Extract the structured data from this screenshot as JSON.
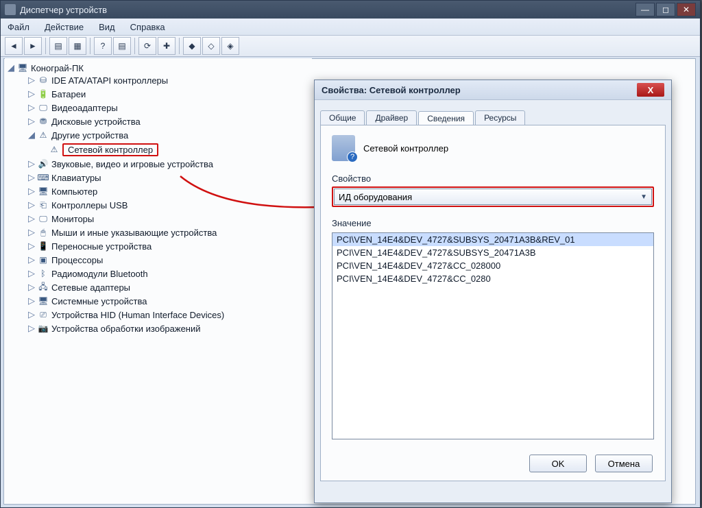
{
  "window": {
    "title": "Диспетчер устройств"
  },
  "menu": {
    "file": "Файл",
    "action": "Действие",
    "view": "Вид",
    "help": "Справка"
  },
  "tree": {
    "root": "Коногрaй-ПК",
    "items": [
      "IDE ATA/ATAPI контроллеры",
      "Батареи",
      "Видеоадаптеры",
      "Дисковые устройства",
      "Другие устройства",
      "Звуковые, видео и игровые устройства",
      "Клавиатуры",
      "Компьютер",
      "Контроллеры USB",
      "Мониторы",
      "Мыши и иные указывающие устройства",
      "Переносные устройства",
      "Процессоры",
      "Радиомодули Bluetooth",
      "Сетевые адаптеры",
      "Системные устройства",
      "Устройства HID (Human Interface Devices)",
      "Устройства обработки изображений"
    ],
    "unknown_device": "Сетевой контроллер"
  },
  "dialog": {
    "title": "Свойства: Сетевой контроллер",
    "tabs": {
      "general": "Общие",
      "driver": "Драйвер",
      "details": "Сведения",
      "resources": "Ресурсы"
    },
    "device_name": "Сетевой контроллер",
    "property_label": "Свойство",
    "property_value": "ИД оборудования",
    "value_label": "Значение",
    "values": [
      "PCI\\VEN_14E4&DEV_4727&SUBSYS_20471A3B&REV_01",
      "PCI\\VEN_14E4&DEV_4727&SUBSYS_20471A3B",
      "PCI\\VEN_14E4&DEV_4727&CC_028000",
      "PCI\\VEN_14E4&DEV_4727&CC_0280"
    ],
    "ok": "OK",
    "cancel": "Отмена"
  }
}
